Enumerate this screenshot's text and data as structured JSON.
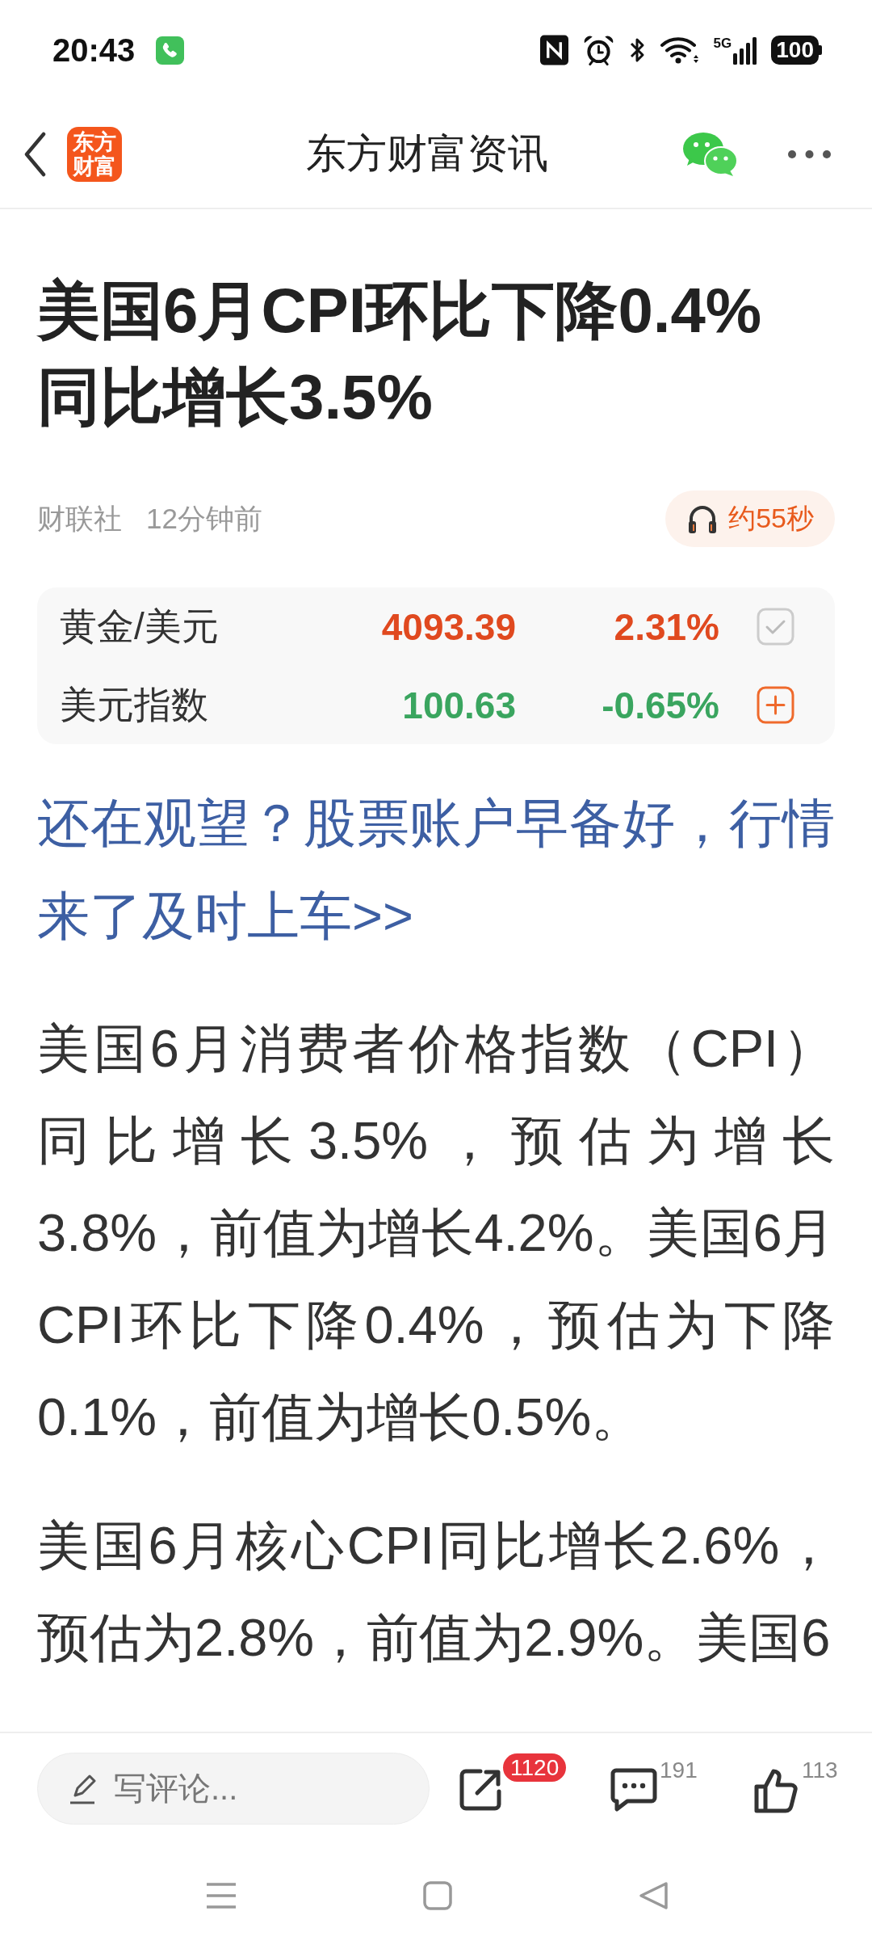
{
  "status_bar": {
    "time": "20:43",
    "network": "5G",
    "battery": "100"
  },
  "header": {
    "logo": "东方财富",
    "title": "东方财富资讯"
  },
  "article": {
    "headline": "美国6月CPI环比下降0.4%同比增长3.5%",
    "source": "财联社",
    "time": "12分钟前",
    "audio_duration": "约55秒",
    "quotes": [
      {
        "name": "黄金/美元",
        "price": "4093.39",
        "change": "2.31%",
        "rising": true,
        "in_watchlist": true
      },
      {
        "name": "美元指数",
        "price": "100.63",
        "change": "-0.65%",
        "rising": false,
        "in_watchlist": false
      }
    ],
    "promo_link": "还在观望？股票账户早备好，行情来了及时上车>>",
    "paragraphs": [
      "美国6月消费者价格指数（CPI）同比增长3.5%，预估为增长3.8%，前值为增长4.2%。美国6月CPI环比下降0.4%，预估为下降0.1%，前值为增长0.5%。",
      "美国6月核心CPI同比增长2.6%，预估为2.8%，前值为2.9%。美国6"
    ]
  },
  "bottom_bar": {
    "comment_placeholder": "写评论...",
    "share_badge": "1120",
    "comment_count": "191",
    "like_count": "113"
  }
}
